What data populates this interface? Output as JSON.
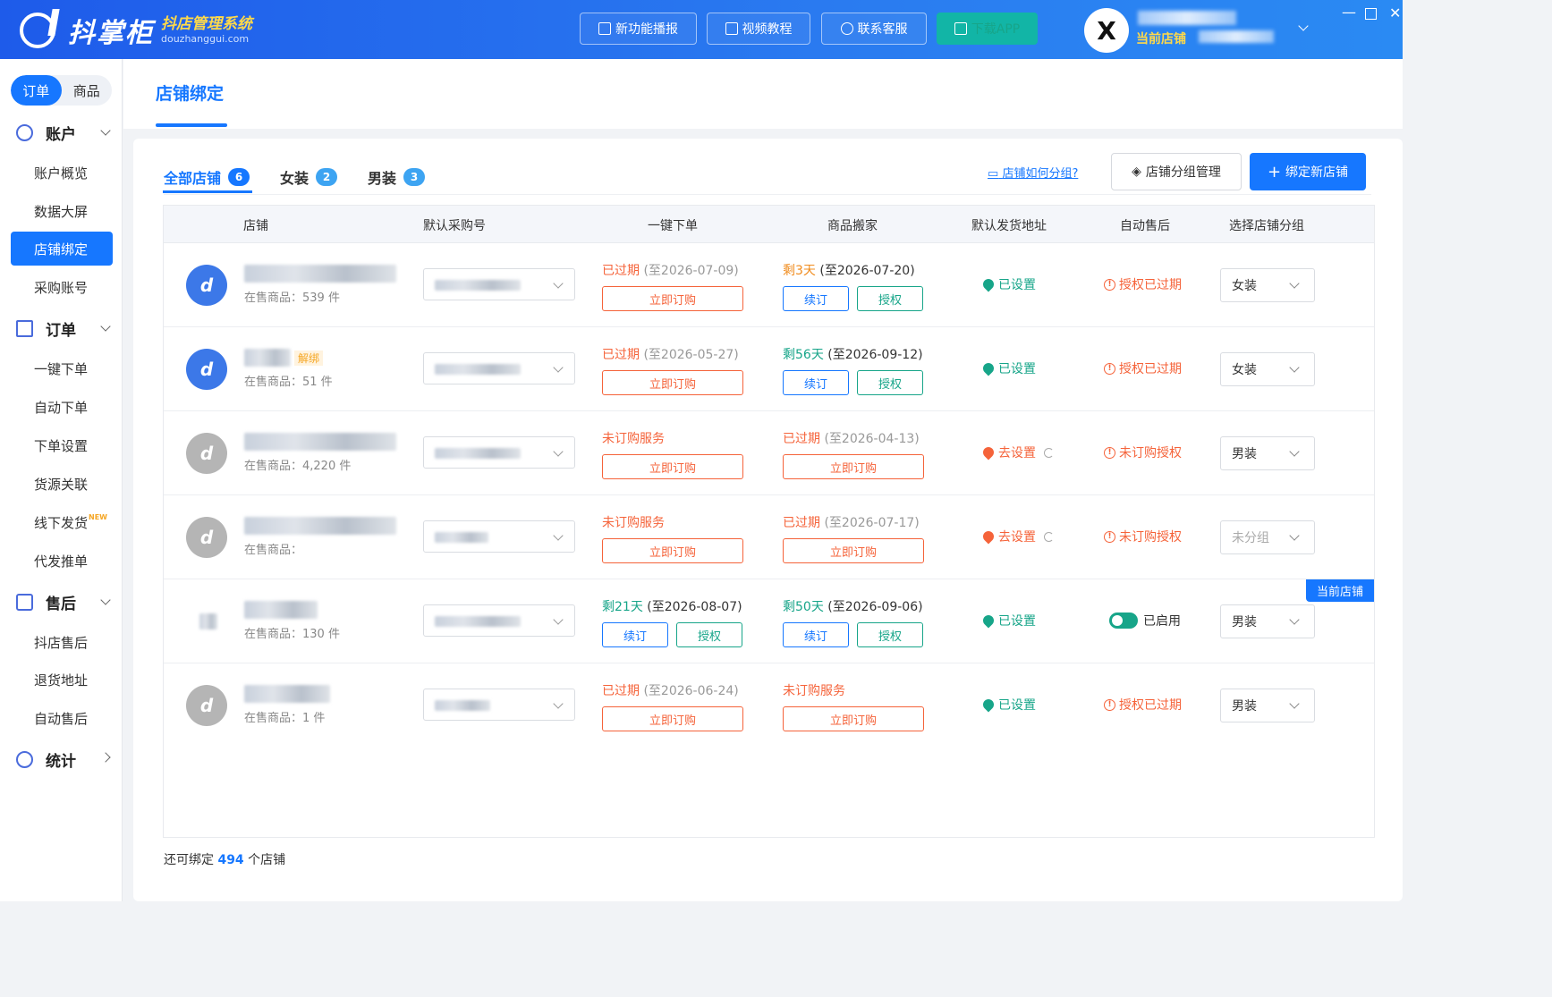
{
  "header": {
    "logo_title": "抖掌柜",
    "logo_sub": "抖店管理系统",
    "logo_domain": "douzhanggui.com",
    "buttons": [
      "新功能播报",
      "视频教程",
      "联系客服",
      "下载APP"
    ],
    "current_store_label": "当前店铺",
    "avatar_letter": "X"
  },
  "sidebar": {
    "seg": [
      "订单",
      "商品"
    ],
    "groups": [
      {
        "label": "账户",
        "items": [
          "账户概览",
          "数据大屏",
          "店铺绑定",
          "采购账号"
        ]
      },
      {
        "label": "订单",
        "items": [
          "一键下单",
          "自动下单",
          "下单设置",
          "货源关联",
          "线下发货",
          "代发推单"
        ]
      },
      {
        "label": "售后",
        "items": [
          "抖店售后",
          "退货地址",
          "自动售后"
        ]
      },
      {
        "label": "统计",
        "items": []
      }
    ],
    "new_tag": "NEW",
    "active_item": "店铺绑定"
  },
  "page": {
    "title": "店铺绑定",
    "tabs": [
      {
        "label": "全部店铺",
        "count": "6"
      },
      {
        "label": "女装",
        "count": "2"
      },
      {
        "label": "男装",
        "count": "3"
      }
    ],
    "help_link": "店铺如何分组?",
    "group_mgmt_button": "店铺分组管理",
    "bind_button": "绑定新店铺",
    "columns": [
      "店铺",
      "默认采购号",
      "一键下单",
      "商品搬家",
      "默认发货地址",
      "自动售后",
      "选择店铺分组"
    ],
    "footer_prefix": "还可绑定",
    "footer_count": "494",
    "footer_suffix": "个店铺"
  },
  "rows": [
    {
      "sub": "在售商品：539 件",
      "order_status": "已过期",
      "order_date": "(至2026-07-09)",
      "order_btn": "立即订购",
      "move_status": "剩3天",
      "move_date": "(至2026-07-20)",
      "move_btn1": "续订",
      "move_btn2": "授权",
      "addr": "已设置",
      "after": "授权已过期",
      "group": "女装"
    },
    {
      "sub": "在售商品：51 件",
      "unbind": "解绑",
      "order_status": "已过期",
      "order_date": "(至2026-05-27)",
      "order_btn": "立即订购",
      "move_status": "剩56天",
      "move_date": "(至2026-09-12)",
      "move_btn1": "续订",
      "move_btn2": "授权",
      "addr": "已设置",
      "after": "授权已过期",
      "group": "女装"
    },
    {
      "sub": "在售商品：4,220 件",
      "order_status": "未订购服务",
      "order_btn": "立即订购",
      "move_status": "已过期",
      "move_date": "(至2026-04-13)",
      "move_btn": "立即订购",
      "addr": "去设置",
      "after": "未订购授权",
      "group": "男装"
    },
    {
      "sub": "在售商品：",
      "order_status": "未订购服务",
      "order_btn": "立即订购",
      "move_status": "已过期",
      "move_date": "(至2026-07-17)",
      "move_btn": "立即订购",
      "addr": "去设置",
      "after": "未订购授权",
      "group": "未分组"
    },
    {
      "sub": "在售商品：130 件",
      "order_status": "剩21天",
      "order_date": "(至2026-08-07)",
      "order_btn1": "续订",
      "order_btn2": "授权",
      "move_status": "剩50天",
      "move_date": "(至2026-09-06)",
      "move_btn1": "续订",
      "move_btn2": "授权",
      "addr": "已设置",
      "after": "已启用",
      "group": "男装",
      "current_tag": "当前店铺"
    },
    {
      "sub": "在售商品：1 件",
      "order_status": "已过期",
      "order_date": "(至2026-06-24)",
      "order_btn": "立即订购",
      "move_status": "未订购服务",
      "move_btn": "立即订购",
      "addr": "已设置",
      "after": "授权已过期",
      "group": "男装"
    }
  ]
}
